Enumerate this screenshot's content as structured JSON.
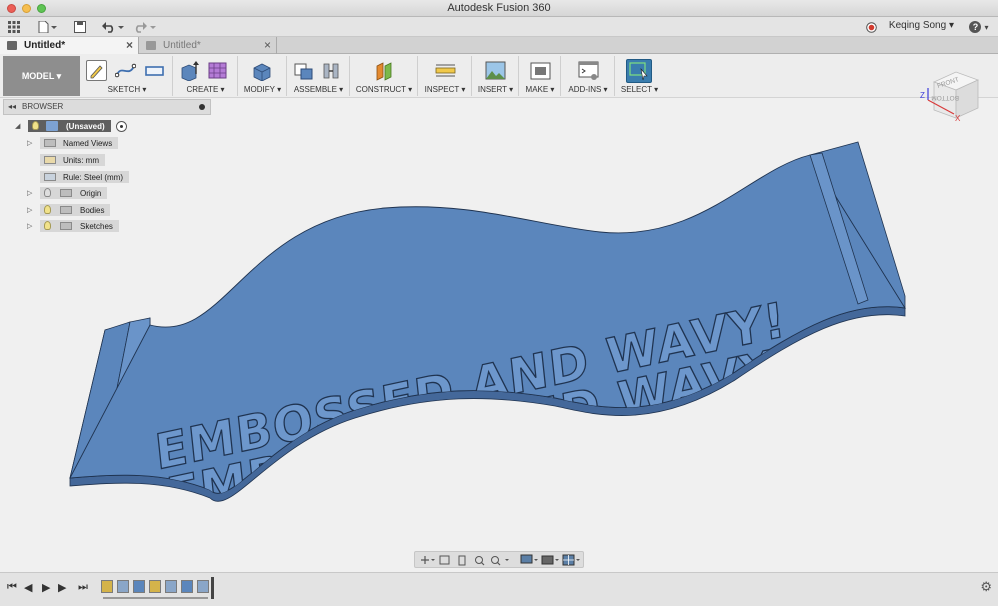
{
  "window": {
    "title": "Autodesk Fusion 360"
  },
  "qat": {
    "user_name": "Keqing Song",
    "help_label": "?"
  },
  "tabs": [
    {
      "label": "Untitled*",
      "active": true
    },
    {
      "label": "Untitled*",
      "active": false
    }
  ],
  "toolbar": {
    "workspace": "MODEL ▾",
    "groups": [
      {
        "label": "SKETCH ▾"
      },
      {
        "label": "CREATE ▾"
      },
      {
        "label": "MODIFY ▾"
      },
      {
        "label": "ASSEMBLE ▾"
      },
      {
        "label": "CONSTRUCT ▾"
      },
      {
        "label": "INSPECT ▾"
      },
      {
        "label": "INSERT ▾"
      },
      {
        "label": "MAKE ▾"
      },
      {
        "label": "ADD-INS ▾"
      },
      {
        "label": "SELECT ▾"
      }
    ]
  },
  "browser": {
    "title": "BROWSER",
    "root": "(Unsaved)",
    "items": [
      {
        "label": "Named Views"
      },
      {
        "label": "Units: mm"
      },
      {
        "label": "Rule: Steel (mm)"
      },
      {
        "label": "Origin"
      },
      {
        "label": "Bodies"
      },
      {
        "label": "Sketches"
      }
    ]
  },
  "viewcube": {
    "front": "FRONT",
    "bottom": "BOTTOM",
    "axis_x": "X",
    "axis_z": "Z"
  },
  "model": {
    "embossed_text": "EMBOSSED AND WAVY!",
    "colors": {
      "body": "#5b86bc",
      "body_dark": "#44689a",
      "text_relief": "#6d97cc",
      "outline": "#1f3350"
    }
  },
  "colors": {
    "accent": "#2c6fb6",
    "select_active": "#3a7dae",
    "record": "#d23a2e"
  }
}
